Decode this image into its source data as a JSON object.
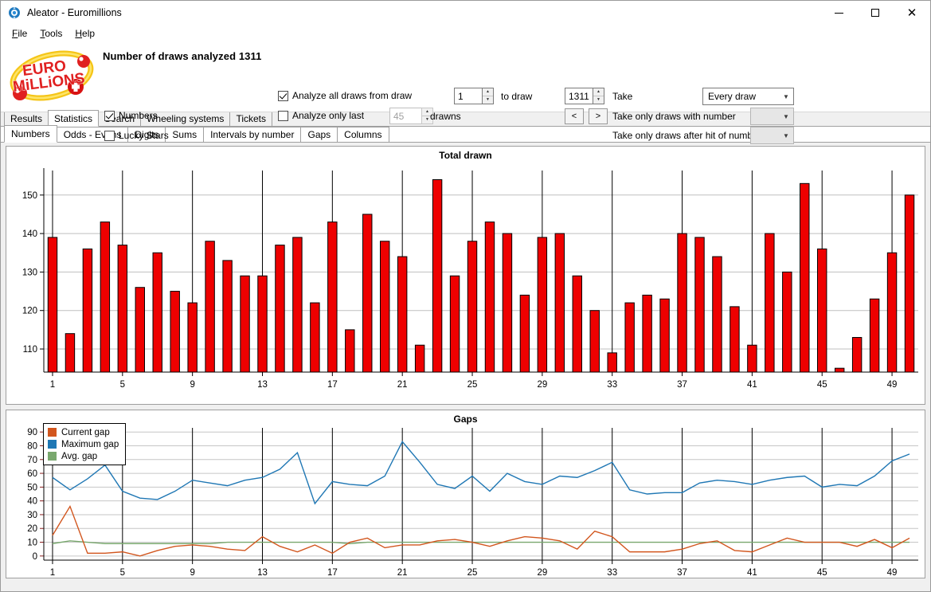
{
  "window": {
    "title": "Aleator - Euromillions",
    "icon": "app-icon",
    "minimize": "—",
    "maximize": "☐",
    "close": "✕"
  },
  "menu": {
    "items": [
      "File",
      "Tools",
      "Help"
    ]
  },
  "options": {
    "logo_line1": "EURO",
    "logo_line2": "MiLLiONS",
    "draws_analyzed_label": "Number of draws analyzed 1311",
    "numbers_label": "Numbers",
    "numbers_checked": true,
    "lucky_stars_label": "Lucky Stars",
    "lucky_stars_checked": false,
    "analyze_all_label": "Analyze all draws from draw",
    "analyze_all_checked": true,
    "analyze_only_last_label": "Analyze only last",
    "analyze_only_last_checked": false,
    "from_draw_value": "1",
    "only_last_value": "45",
    "drawns_label": "drawns",
    "to_draw_label": "to draw",
    "to_draw_value": "1311",
    "take_label": "Take",
    "take_value": "Every draw",
    "take_with_number_label": "Take only draws with number",
    "take_with_number_value": "",
    "take_after_hit_label": "Take only draws after hit of number",
    "take_after_hit_value": "",
    "prev_label": "<",
    "next_label": ">"
  },
  "tabs": {
    "main": [
      "Results",
      "Statistics",
      "Search",
      "Wheeling systems",
      "Tickets"
    ],
    "main_active": "Statistics",
    "sub": [
      "Numbers",
      "Odds - Evens",
      "Digits",
      "Sums",
      "Intervals by number",
      "Gaps",
      "Columns"
    ],
    "sub_active": "Numbers"
  },
  "chart_data": [
    {
      "type": "bar",
      "title": "Total drawn",
      "xlabel": "",
      "ylabel": "",
      "bar_color": "#ee0000",
      "bar_edge": "#000000",
      "grid": true,
      "ylim": [
        104,
        157
      ],
      "yticks": [
        110,
        120,
        130,
        140,
        150
      ],
      "xticks": [
        1,
        5,
        9,
        13,
        17,
        21,
        25,
        29,
        33,
        37,
        41,
        45,
        49
      ],
      "categories": [
        1,
        2,
        3,
        4,
        5,
        6,
        7,
        8,
        9,
        10,
        11,
        12,
        13,
        14,
        15,
        16,
        17,
        18,
        19,
        20,
        21,
        22,
        23,
        24,
        25,
        26,
        27,
        28,
        29,
        30,
        31,
        32,
        33,
        34,
        35,
        36,
        37,
        38,
        39,
        40,
        41,
        42,
        43,
        44,
        45,
        46,
        47,
        48,
        49,
        50
      ],
      "values": [
        139,
        114,
        136,
        143,
        137,
        126,
        135,
        125,
        122,
        138,
        133,
        129,
        129,
        137,
        139,
        122,
        143,
        115,
        145,
        138,
        134,
        111,
        154,
        129,
        138,
        143,
        140,
        124,
        139,
        140,
        129,
        120,
        109,
        122,
        124,
        123,
        140,
        139,
        134,
        121,
        111,
        140,
        130,
        153,
        136,
        105,
        113,
        123,
        135,
        150
      ]
    },
    {
      "type": "line",
      "title": "Gaps",
      "xlabel": "",
      "ylabel": "",
      "grid": true,
      "ylim": [
        -3,
        93
      ],
      "yticks": [
        0,
        10,
        20,
        30,
        40,
        50,
        60,
        70,
        80,
        90
      ],
      "xticks": [
        1,
        5,
        9,
        13,
        17,
        21,
        25,
        29,
        33,
        37,
        41,
        45,
        49
      ],
      "x": [
        1,
        2,
        3,
        4,
        5,
        6,
        7,
        8,
        9,
        10,
        11,
        12,
        13,
        14,
        15,
        16,
        17,
        18,
        19,
        20,
        21,
        22,
        23,
        24,
        25,
        26,
        27,
        28,
        29,
        30,
        31,
        32,
        33,
        34,
        35,
        36,
        37,
        38,
        39,
        40,
        41,
        42,
        43,
        44,
        45,
        46,
        47,
        48,
        49,
        50
      ],
      "legend_position": "top-left",
      "series": [
        {
          "name": "Current gap",
          "color": "#d2561e",
          "values": [
            15,
            36,
            2,
            2,
            3,
            0,
            4,
            7,
            8,
            7,
            5,
            4,
            14,
            7,
            3,
            8,
            2,
            10,
            13,
            6,
            8,
            8,
            11,
            12,
            10,
            7,
            11,
            14,
            13,
            11,
            5,
            18,
            14,
            3,
            3,
            3,
            5,
            9,
            11,
            4,
            3,
            8,
            13,
            10,
            10,
            10,
            7,
            12,
            6,
            13
          ]
        },
        {
          "name": "Maximum gap",
          "color": "#1f77b4",
          "values": [
            57,
            48,
            56,
            66,
            47,
            42,
            41,
            47,
            55,
            53,
            51,
            55,
            57,
            63,
            75,
            38,
            54,
            52,
            51,
            58,
            83,
            68,
            52,
            49,
            58,
            47,
            60,
            54,
            52,
            58,
            57,
            62,
            68,
            48,
            45,
            46,
            46,
            53,
            55,
            54,
            52,
            55,
            57,
            58,
            50,
            52,
            51,
            58,
            69,
            74
          ]
        },
        {
          "name": "Avg. gap",
          "color": "#79a86e",
          "values": [
            9,
            11,
            10,
            9,
            9,
            9,
            9,
            9,
            9,
            9,
            10,
            10,
            10,
            10,
            10,
            10,
            10,
            9,
            10,
            10,
            10,
            10,
            10,
            10,
            10,
            10,
            10,
            10,
            10,
            10,
            10,
            10,
            10,
            10,
            10,
            10,
            10,
            10,
            10,
            10,
            10,
            10,
            10,
            10,
            10,
            10,
            10,
            10,
            10,
            10
          ]
        }
      ]
    }
  ]
}
